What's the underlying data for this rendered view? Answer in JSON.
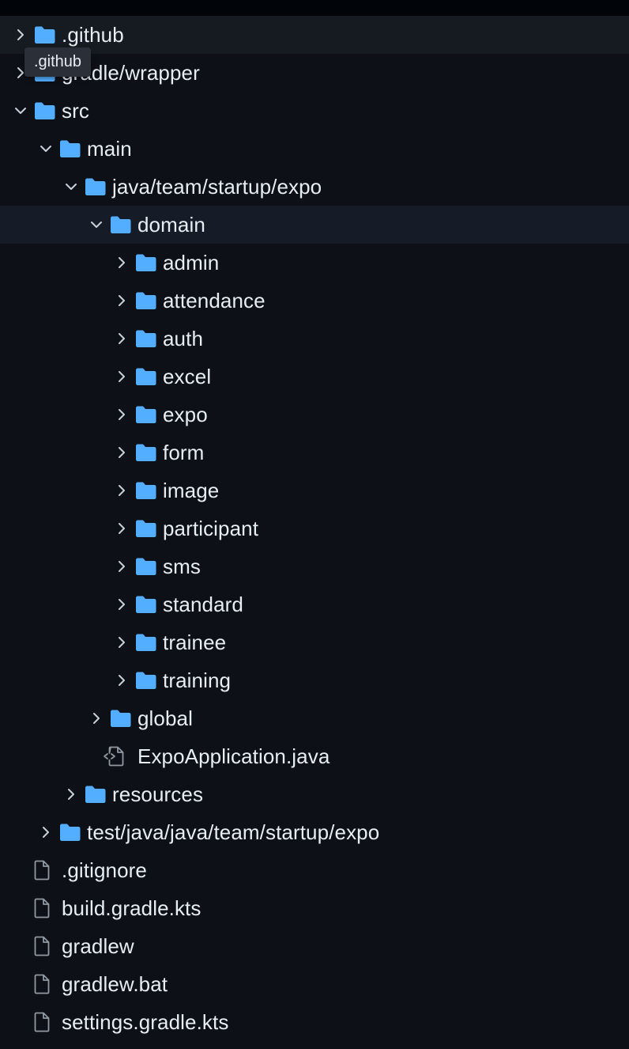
{
  "colors": {
    "background": "#0d1117",
    "folder": "#54aeff",
    "text": "#e6edf3",
    "chevron": "#c9d1d9",
    "file_icon": "#9198a1",
    "row_highlight": "#161b22"
  },
  "tooltip": ".github",
  "tree": [
    {
      "label": ".github",
      "kind": "folder",
      "expanded": false,
      "depth": 0,
      "hl": true
    },
    {
      "label": "gradle/wrapper",
      "kind": "folder",
      "expanded": false,
      "depth": 0
    },
    {
      "label": "src",
      "kind": "folder",
      "expanded": true,
      "depth": 0
    },
    {
      "label": "main",
      "kind": "folder",
      "expanded": true,
      "depth": 1
    },
    {
      "label": "java/team/startup/expo",
      "kind": "folder",
      "expanded": true,
      "depth": 2
    },
    {
      "label": "domain",
      "kind": "folder",
      "expanded": true,
      "depth": 3,
      "sel": true
    },
    {
      "label": "admin",
      "kind": "folder",
      "expanded": false,
      "depth": 4
    },
    {
      "label": "attendance",
      "kind": "folder",
      "expanded": false,
      "depth": 4
    },
    {
      "label": "auth",
      "kind": "folder",
      "expanded": false,
      "depth": 4
    },
    {
      "label": "excel",
      "kind": "folder",
      "expanded": false,
      "depth": 4
    },
    {
      "label": "expo",
      "kind": "folder",
      "expanded": false,
      "depth": 4
    },
    {
      "label": "form",
      "kind": "folder",
      "expanded": false,
      "depth": 4
    },
    {
      "label": "image",
      "kind": "folder",
      "expanded": false,
      "depth": 4
    },
    {
      "label": "participant",
      "kind": "folder",
      "expanded": false,
      "depth": 4
    },
    {
      "label": "sms",
      "kind": "folder",
      "expanded": false,
      "depth": 4
    },
    {
      "label": "standard",
      "kind": "folder",
      "expanded": false,
      "depth": 4
    },
    {
      "label": "trainee",
      "kind": "folder",
      "expanded": false,
      "depth": 4
    },
    {
      "label": "training",
      "kind": "folder",
      "expanded": false,
      "depth": 4
    },
    {
      "label": "global",
      "kind": "folder",
      "expanded": false,
      "depth": 3
    },
    {
      "label": "ExpoApplication.java",
      "kind": "code-file",
      "depth": 3
    },
    {
      "label": "resources",
      "kind": "folder",
      "expanded": false,
      "depth": 2
    },
    {
      "label": "test/java/java/team/startup/expo",
      "kind": "folder",
      "expanded": false,
      "depth": 1
    },
    {
      "label": ".gitignore",
      "kind": "file",
      "depth": 0
    },
    {
      "label": "build.gradle.kts",
      "kind": "file",
      "depth": 0
    },
    {
      "label": "gradlew",
      "kind": "file",
      "depth": 0
    },
    {
      "label": "gradlew.bat",
      "kind": "file",
      "depth": 0
    },
    {
      "label": "settings.gradle.kts",
      "kind": "file",
      "depth": 0
    }
  ]
}
